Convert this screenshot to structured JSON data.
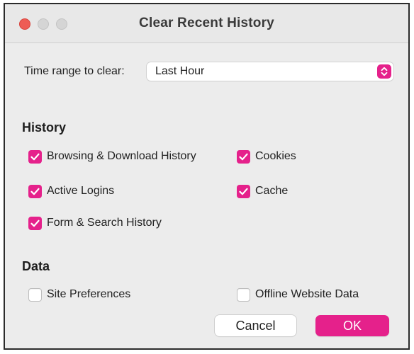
{
  "window": {
    "title": "Clear Recent History"
  },
  "time_range": {
    "label": "Time range to clear:",
    "selected": "Last Hour"
  },
  "history": {
    "heading": "History",
    "items": [
      {
        "label": "Browsing & Download History",
        "checked": true
      },
      {
        "label": "Cookies",
        "checked": true
      },
      {
        "label": "Active Logins",
        "checked": true
      },
      {
        "label": "Cache",
        "checked": true
      },
      {
        "label": "Form & Search History",
        "checked": true
      }
    ]
  },
  "data": {
    "heading": "Data",
    "items": [
      {
        "label": "Site Preferences",
        "checked": false
      },
      {
        "label": "Offline Website Data",
        "checked": false
      }
    ]
  },
  "buttons": {
    "cancel": "Cancel",
    "ok": "OK"
  },
  "colors": {
    "accent": "#e5218b",
    "close": "#ee5c55",
    "window_bg": "#ececec"
  },
  "icons": {
    "checkmark": "checkmark-icon",
    "stepper": "chevron-up-down-icon"
  }
}
